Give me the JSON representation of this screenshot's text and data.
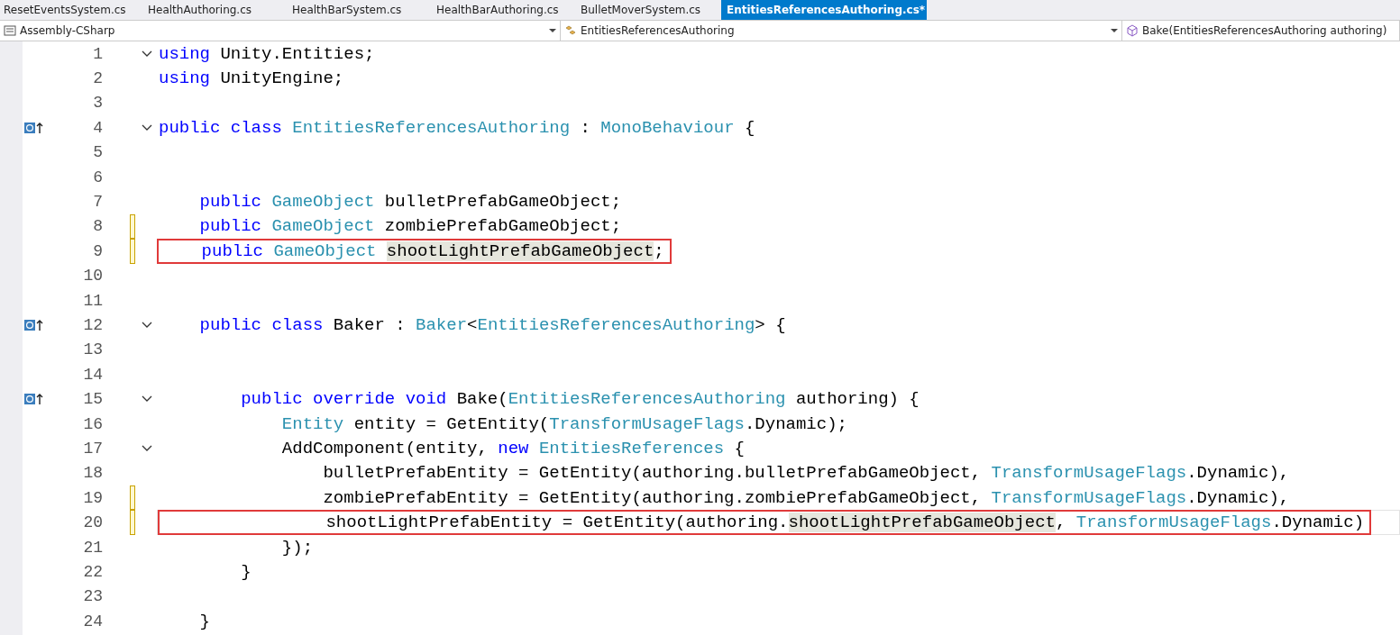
{
  "tabs": [
    {
      "label": "ResetEventsSystem.cs",
      "selected": false
    },
    {
      "label": "HealthAuthoring.cs",
      "selected": false
    },
    {
      "label": "HealthBarSystem.cs",
      "selected": false
    },
    {
      "label": "HealthBarAuthoring.cs",
      "selected": false
    },
    {
      "label": "BulletMoverSystem.cs",
      "selected": false
    },
    {
      "label": "EntitiesReferencesAuthoring.cs*",
      "selected": true
    }
  ],
  "nav": [
    {
      "kind": "project",
      "label": "Assembly-CSharp"
    },
    {
      "kind": "class",
      "label": "EntitiesReferencesAuthoring"
    },
    {
      "kind": "member",
      "label": "Bake(EntitiesReferencesAuthoring authoring)"
    }
  ],
  "lines": [
    {
      "num": "1",
      "fold": true,
      "tokens": [
        {
          "t": "using ",
          "kind": "kw"
        },
        {
          "t": "Unity.Entities;",
          "kind": "plain"
        }
      ]
    },
    {
      "num": "2",
      "tokens": [
        {
          "t": "using ",
          "kind": "kw"
        },
        {
          "t": "UnityEngine;",
          "kind": "plain"
        }
      ]
    },
    {
      "num": "3"
    },
    {
      "num": "4",
      "fold": true,
      "ref": true,
      "tokens": [
        {
          "t": "public class ",
          "kind": "kw"
        },
        {
          "t": "EntitiesReferencesAuthoring",
          "kind": "type"
        },
        {
          "t": " : ",
          "kind": "plain"
        },
        {
          "t": "MonoBehaviour",
          "kind": "type"
        },
        {
          "t": " {",
          "kind": "plain"
        }
      ]
    },
    {
      "num": "5"
    },
    {
      "num": "6"
    },
    {
      "num": "7",
      "tokens": [
        {
          "t": "    public ",
          "kind": "kw"
        },
        {
          "t": "GameObject",
          "kind": "type"
        },
        {
          "t": " bulletPrefabGameObject;",
          "kind": "plain"
        }
      ]
    },
    {
      "num": "8",
      "changed": true,
      "tokens": [
        {
          "t": "    public ",
          "kind": "kw"
        },
        {
          "t": "GameObject",
          "kind": "type"
        },
        {
          "t": " zombiePrefabGameObject;",
          "kind": "plain"
        }
      ]
    },
    {
      "num": "9",
      "changed": true,
      "boxed": true,
      "tokens": [
        {
          "t": "    public ",
          "kind": "kw"
        },
        {
          "t": "GameObject ",
          "kind": "type"
        },
        {
          "t": "shootLightPrefabGameObject",
          "kind": "hl"
        },
        {
          "t": ";",
          "kind": "plain"
        }
      ]
    },
    {
      "num": "10"
    },
    {
      "num": "11"
    },
    {
      "num": "12",
      "fold": true,
      "ref": true,
      "tokens": [
        {
          "t": "    public class ",
          "kind": "kw"
        },
        {
          "t": "Baker : ",
          "kind": "plain"
        },
        {
          "t": "Baker",
          "kind": "type"
        },
        {
          "t": "<",
          "kind": "plain"
        },
        {
          "t": "EntitiesReferencesAuthoring",
          "kind": "type"
        },
        {
          "t": "> {",
          "kind": "plain"
        }
      ]
    },
    {
      "num": "13"
    },
    {
      "num": "14"
    },
    {
      "num": "15",
      "fold": true,
      "ref": true,
      "tokens": [
        {
          "t": "        public override void ",
          "kind": "kw"
        },
        {
          "t": "Bake(",
          "kind": "plain"
        },
        {
          "t": "EntitiesReferencesAuthoring",
          "kind": "type"
        },
        {
          "t": " authoring) {",
          "kind": "plain"
        }
      ]
    },
    {
      "num": "16",
      "tokens": [
        {
          "t": "            Entity",
          "kind": "type"
        },
        {
          "t": " entity = GetEntity(",
          "kind": "plain"
        },
        {
          "t": "TransformUsageFlags",
          "kind": "type"
        },
        {
          "t": ".Dynamic);",
          "kind": "plain"
        }
      ]
    },
    {
      "num": "17",
      "fold": true,
      "tokens": [
        {
          "t": "            AddComponent(entity, ",
          "kind": "plain"
        },
        {
          "t": "new ",
          "kind": "kw"
        },
        {
          "t": "EntitiesReferences",
          "kind": "type"
        },
        {
          "t": " {",
          "kind": "plain"
        }
      ]
    },
    {
      "num": "18",
      "tokens": [
        {
          "t": "                bulletPrefabEntity = GetEntity(authoring.bulletPrefabGameObject, ",
          "kind": "plain"
        },
        {
          "t": "TransformUsageFlags",
          "kind": "type"
        },
        {
          "t": ".Dynamic),",
          "kind": "plain"
        }
      ]
    },
    {
      "num": "19",
      "changed": true,
      "tokens": [
        {
          "t": "                zombiePrefabEntity = GetEntity(authoring.zombiePrefabGameObject, ",
          "kind": "plain"
        },
        {
          "t": "TransformUsageFlags",
          "kind": "type"
        },
        {
          "t": ".Dynamic),",
          "kind": "plain"
        }
      ]
    },
    {
      "num": "20",
      "changed": true,
      "current": true,
      "boxed": true,
      "tokens": [
        {
          "t": "                shootLightPrefabEntity = GetEntity(authoring.",
          "kind": "plain"
        },
        {
          "t": "shootLightPrefabGameObject",
          "kind": "hl"
        },
        {
          "t": ", ",
          "kind": "plain"
        },
        {
          "t": "TransformUsageFlags",
          "kind": "type"
        },
        {
          "t": ".Dynamic)",
          "kind": "plain"
        }
      ]
    },
    {
      "num": "21",
      "tokens": [
        {
          "t": "            });",
          "kind": "plain"
        }
      ]
    },
    {
      "num": "22",
      "tokens": [
        {
          "t": "        }",
          "kind": "plain"
        }
      ]
    },
    {
      "num": "23"
    },
    {
      "num": "24",
      "tokens": [
        {
          "t": "    }",
          "kind": "plain"
        }
      ]
    }
  ]
}
